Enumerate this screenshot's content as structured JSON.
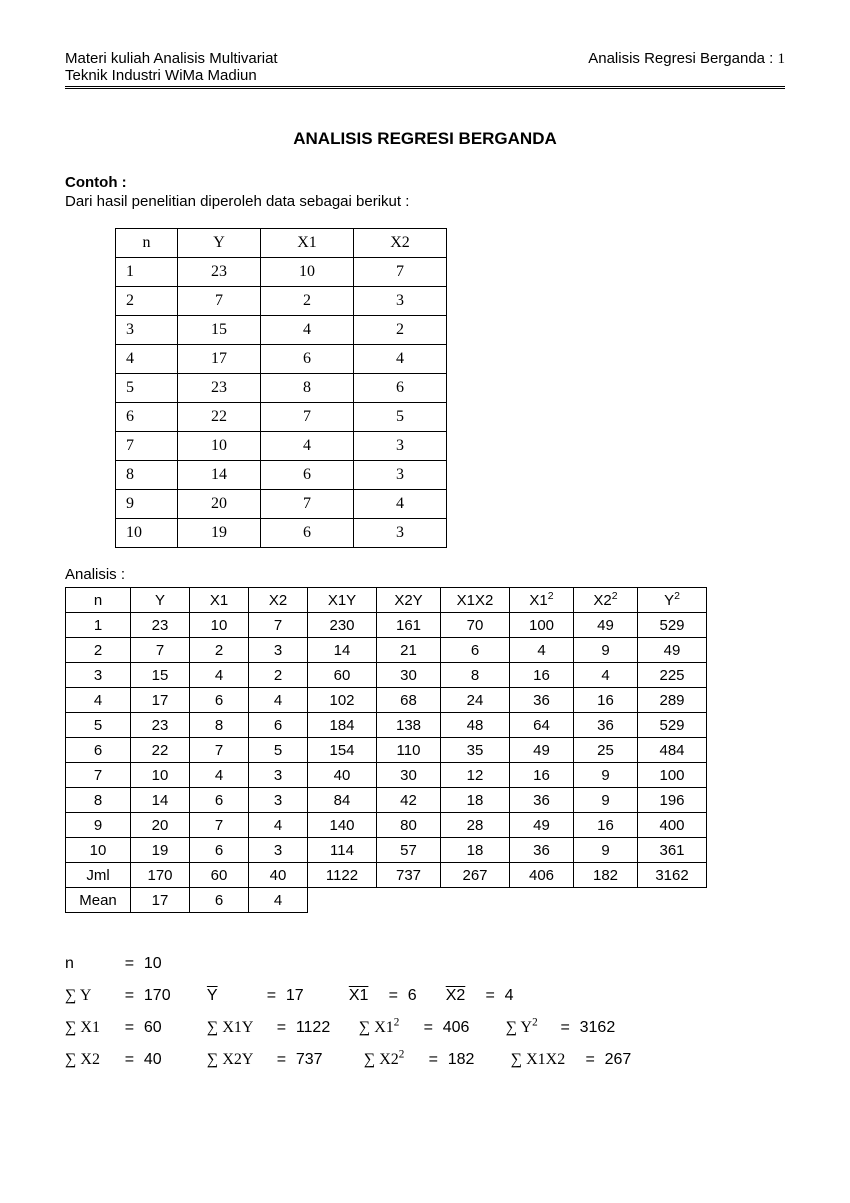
{
  "header": {
    "left1": "Materi kuliah Analisis Multivariat",
    "left2": "Teknik Industri WiMa Madiun",
    "right_label": "Analisis Regresi Berganda : ",
    "page": "1"
  },
  "title": "ANALISIS REGRESI BERGANDA",
  "contoh_label": "Contoh :",
  "contoh_desc": "Dari hasil penelitian diperoleh data sebagai berikut :",
  "table1": {
    "headers": [
      "n",
      "Y",
      "X1",
      "X2"
    ],
    "rows": [
      [
        "1",
        "23",
        "10",
        "7"
      ],
      [
        "2",
        "7",
        "2",
        "3"
      ],
      [
        "3",
        "15",
        "4",
        "2"
      ],
      [
        "4",
        "17",
        "6",
        "4"
      ],
      [
        "5",
        "23",
        "8",
        "6"
      ],
      [
        "6",
        "22",
        "7",
        "5"
      ],
      [
        "7",
        "10",
        "4",
        "3"
      ],
      [
        "8",
        "14",
        "6",
        "3"
      ],
      [
        "9",
        "20",
        "7",
        "4"
      ],
      [
        "10",
        "19",
        "6",
        "3"
      ]
    ]
  },
  "analisis_label": "Analisis :",
  "table2": {
    "headers": [
      "n",
      "Y",
      "X1",
      "X2",
      "X1Y",
      "X2Y",
      "X1X2",
      "X1²",
      "X2²",
      "Y²"
    ],
    "rows": [
      [
        "1",
        "23",
        "10",
        "7",
        "230",
        "161",
        "70",
        "100",
        "49",
        "529"
      ],
      [
        "2",
        "7",
        "2",
        "3",
        "14",
        "21",
        "6",
        "4",
        "9",
        "49"
      ],
      [
        "3",
        "15",
        "4",
        "2",
        "60",
        "30",
        "8",
        "16",
        "4",
        "225"
      ],
      [
        "4",
        "17",
        "6",
        "4",
        "102",
        "68",
        "24",
        "36",
        "16",
        "289"
      ],
      [
        "5",
        "23",
        "8",
        "6",
        "184",
        "138",
        "48",
        "64",
        "36",
        "529"
      ],
      [
        "6",
        "22",
        "7",
        "5",
        "154",
        "110",
        "35",
        "49",
        "25",
        "484"
      ],
      [
        "7",
        "10",
        "4",
        "3",
        "40",
        "30",
        "12",
        "16",
        "9",
        "100"
      ],
      [
        "8",
        "14",
        "6",
        "3",
        "84",
        "42",
        "18",
        "36",
        "9",
        "196"
      ],
      [
        "9",
        "20",
        "7",
        "4",
        "140",
        "80",
        "28",
        "49",
        "16",
        "400"
      ],
      [
        "10",
        "19",
        "6",
        "3",
        "114",
        "57",
        "18",
        "36",
        "9",
        "361"
      ]
    ],
    "jml_label": "Jml",
    "jml": [
      "170",
      "60",
      "40",
      "1122",
      "737",
      "267",
      "406",
      "182",
      "3162"
    ],
    "mean_label": "Mean",
    "mean": [
      "17",
      "6",
      "4"
    ]
  },
  "summary": {
    "n_label": "n",
    "n_val": "10",
    "sumY_label": "∑ Y",
    "sumY_val": "170",
    "Ybar_label": "Y",
    "Ybar_val": "17",
    "X1bar_label": "X1",
    "X1bar_val": "6",
    "X2bar_label": "X2",
    "X2bar_val": "4",
    "sumX1_label": "∑ X1",
    "sumX1_val": "60",
    "sumX1Y_label": "∑ X1Y",
    "sumX1Y_val": "1122",
    "sumX1sq_label": "∑ X1²",
    "sumX1sq_val": "406",
    "sumYsq_label": "∑ Y²",
    "sumYsq_val": "3162",
    "sumX2_label": "∑ X2",
    "sumX2_val": "40",
    "sumX2Y_label": "∑ X2Y",
    "sumX2Y_val": "737",
    "sumX2sq_label": "∑ X2²",
    "sumX2sq_val": "182",
    "sumX1X2_label": "∑ X1X2",
    "sumX1X2_val": "267",
    "eq": "="
  }
}
